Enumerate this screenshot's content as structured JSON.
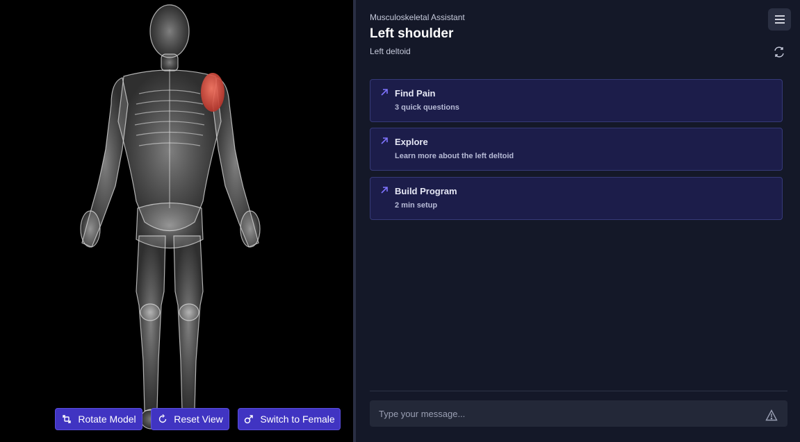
{
  "viewer": {
    "buttons": {
      "rotate": "Rotate Model",
      "reset": "Reset View",
      "switch": "Switch to Female"
    },
    "highlight_color": "#e05a4a"
  },
  "panel": {
    "app_name": "Musculoskeletal Assistant",
    "region_title": "Left shoulder",
    "muscle_name": "Left deltoid",
    "cards": [
      {
        "title": "Find Pain",
        "subtitle": "3 quick questions"
      },
      {
        "title": "Explore",
        "subtitle": "Learn more about the left deltoid"
      },
      {
        "title": "Build Program",
        "subtitle": "2 min setup"
      }
    ],
    "input_placeholder": "Type your message..."
  },
  "colors": {
    "accent": "#4034c2",
    "card_bg": "#1c1d4a",
    "panel_bg": "#141828"
  }
}
